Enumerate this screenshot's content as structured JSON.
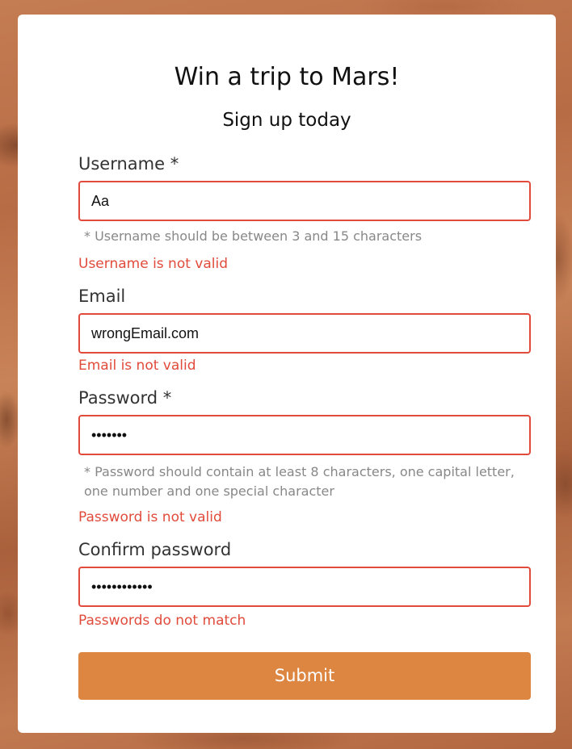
{
  "header": {
    "title": "Win a trip to Mars!",
    "subtitle": "Sign up today"
  },
  "form": {
    "username": {
      "label": "Username *",
      "value": "Aa",
      "hint": "* Username should be between 3 and 15 characters",
      "error": "Username is not valid"
    },
    "email": {
      "label": "Email",
      "value": "wrongEmail.com",
      "error": "Email is not valid"
    },
    "password": {
      "label": "Password *",
      "value": "•••••••",
      "hint_line1": "* Password should contain at least 8 characters, one capital letter,",
      "hint_line2": "one number and one special character",
      "error": "Password is not valid"
    },
    "confirm_password": {
      "label": "Confirm password",
      "value": "••••••••••••",
      "error": "Passwords do not match"
    },
    "submit_label": "Submit"
  },
  "colors": {
    "error": "#e14b3b",
    "button": "#dd8641",
    "hint": "#888888"
  }
}
